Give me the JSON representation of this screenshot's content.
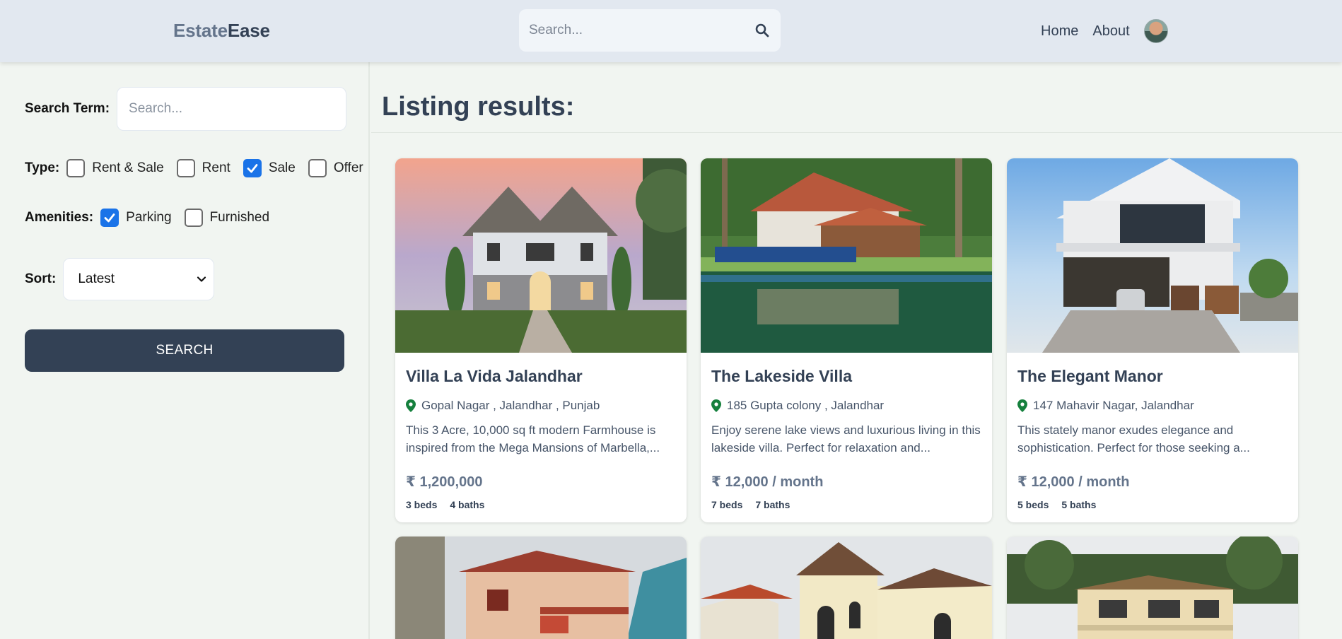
{
  "header": {
    "logo_part1": "Estate",
    "logo_part2": "Ease",
    "search_placeholder": "Search...",
    "nav": [
      "Home",
      "About"
    ]
  },
  "sidebar": {
    "search_term_label": "Search Term:",
    "search_term_placeholder": "Search...",
    "type_label": "Type:",
    "type_options": [
      {
        "label": "Rent & Sale",
        "checked": false
      },
      {
        "label": "Rent",
        "checked": false
      },
      {
        "label": "Sale",
        "checked": true
      },
      {
        "label": "Offer",
        "checked": false
      }
    ],
    "amenities_label": "Amenities:",
    "amenities_options": [
      {
        "label": "Parking",
        "checked": true
      },
      {
        "label": "Furnished",
        "checked": false
      }
    ],
    "sort_label": "Sort:",
    "sort_value": "Latest",
    "search_button": "SEARCH"
  },
  "main": {
    "title": "Listing results:",
    "listings": [
      {
        "title": "Villa La Vida Jalandhar",
        "location": "Gopal Nagar , Jalandhar , Punjab",
        "description": "This 3 Acre, 10,000 sq ft modern Farmhouse is inspired from the Mega Mansions of Marbella,...",
        "price": "₹ 1,200,000",
        "beds": "3 beds",
        "baths": "4 baths"
      },
      {
        "title": "The Lakeside Villa",
        "location": "185 Gupta colony , Jalandhar",
        "description": "Enjoy serene lake views and luxurious living in this lakeside villa. Perfect for relaxation and...",
        "price": "₹ 12,000 / month",
        "beds": "7 beds",
        "baths": "7 baths"
      },
      {
        "title": "The Elegant Manor",
        "location": "147 Mahavir Nagar, Jalandhar",
        "description": "This stately manor exudes elegance and sophistication. Perfect for those seeking a...",
        "price": "₹ 12,000 / month",
        "beds": "5 beds",
        "baths": "5 baths"
      }
    ]
  },
  "colors": {
    "header_bg": "#e2e8f0",
    "page_bg": "#f1f5f1",
    "primary": "#334155",
    "checkbox_on": "#1a73e8",
    "pin": "#15803d"
  }
}
